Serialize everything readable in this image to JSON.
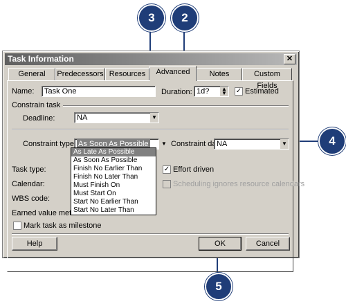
{
  "window": {
    "title": "Task Information",
    "close_glyph": "✕"
  },
  "tabs": [
    {
      "label": "General"
    },
    {
      "label": "Predecessors"
    },
    {
      "label": "Resources"
    },
    {
      "label": "Advanced"
    },
    {
      "label": "Notes"
    },
    {
      "label": "Custom Fields"
    }
  ],
  "form": {
    "name_label": "Name:",
    "name_value": "Task One",
    "duration_label": "Duration:",
    "duration_value": "1d?",
    "estimated_label": "Estimated",
    "constrain_task_label": "Constrain task",
    "deadline_label": "Deadline:",
    "deadline_value": "NA",
    "constraint_type_label": "Constraint type:",
    "constraint_type_value": "As Soon As Possible",
    "constraint_date_label": "Constraint date:",
    "constraint_date_value": "NA",
    "task_type_label": "Task type:",
    "calendar_label": "Calendar:",
    "wbs_code_label": "WBS code:",
    "earned_value_label": "Earned value method:",
    "effort_driven_label": "Effort driven",
    "scheduling_label": "Scheduling ignores resource calendars",
    "milestone_label": "Mark task as milestone",
    "check_glyph": "✓"
  },
  "constraint_options": [
    "As Late As Possible",
    "As Soon As Possible",
    "Finish No Earlier Than",
    "Finish No Later Than",
    "Must Finish On",
    "Must Start On",
    "Start No Earlier Than",
    "Start No Later Than"
  ],
  "buttons": {
    "help": "Help",
    "ok": "OK",
    "cancel": "Cancel"
  },
  "callouts": [
    "3",
    "2",
    "4",
    "5"
  ],
  "colors": {
    "callout": "#1f3d78",
    "dialog_bg": "#d4d0c8"
  }
}
